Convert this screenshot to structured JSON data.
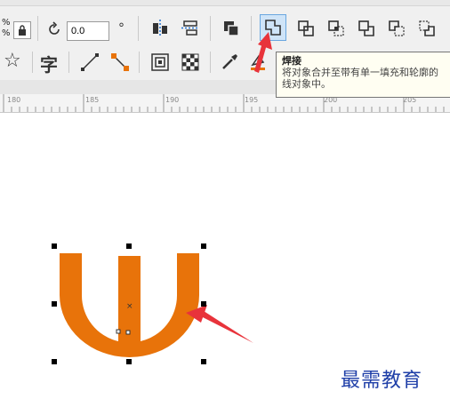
{
  "toolbar": {
    "percent_top": "%",
    "percent_bottom": "%",
    "rotation_value": "0.0",
    "degree_symbol": "°",
    "row1_buttons": [
      "align-icon",
      "distribute-icon",
      "order-icon",
      "weld-icon",
      "trim-icon",
      "intersect-icon",
      "simplify-icon",
      "front-minus-back-icon",
      "back-minus-front-icon"
    ],
    "row2_buttons": [
      "star-icon",
      "text-icon",
      "line-icon",
      "connector-icon",
      "contour-icon",
      "transparency-icon",
      "eyedropper-icon",
      "fill-icon"
    ],
    "text_tool_glyph": "字",
    "star_glyph": "☆",
    "active_button": "weld-icon"
  },
  "tooltip": {
    "title": "焊接",
    "line1": "将对象合并至带有单一填充和轮廓的",
    "line2": "线对象中。"
  },
  "ruler": {
    "labels": [
      "180",
      "185",
      "190",
      "195",
      "200",
      "205"
    ]
  },
  "canvas": {
    "shape_color": "#e8730a",
    "arrow_color": "#e8333b"
  },
  "watermark": "最需教育"
}
